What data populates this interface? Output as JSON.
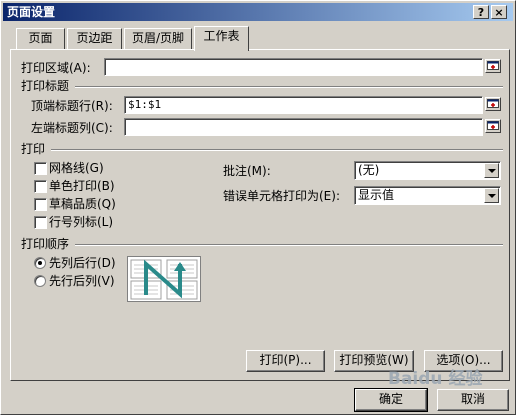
{
  "window": {
    "title": "页面设置",
    "help_label": "?",
    "close_label": "×"
  },
  "tabs": [
    {
      "label": "页面"
    },
    {
      "label": "页边距"
    },
    {
      "label": "页眉/页脚"
    },
    {
      "label": "工作表"
    }
  ],
  "print_area": {
    "label": "打印区域(A):",
    "value": ""
  },
  "print_titles": {
    "header": "打印标题",
    "rows_label": "顶端标题行(R):",
    "rows_value": "$1:$1",
    "cols_label": "左端标题列(C):",
    "cols_value": ""
  },
  "print": {
    "header": "打印",
    "gridlines": {
      "label": "网格线(G)",
      "checked": false
    },
    "black_white": {
      "label": "单色打印(B)",
      "checked": false
    },
    "draft": {
      "label": "草稿品质(Q)",
      "checked": false
    },
    "row_col_headings": {
      "label": "行号列标(L)",
      "checked": false
    },
    "comments_label": "批注(M):",
    "comments_value": "(无)",
    "errors_label": "错误单元格打印为(E):",
    "errors_value": "显示值"
  },
  "page_order": {
    "header": "打印顺序",
    "down_then_over": {
      "label": "先列后行(D)",
      "selected": true
    },
    "over_then_down": {
      "label": "先行后列(V)",
      "selected": false
    }
  },
  "panel_buttons": {
    "print": "打印(P)...",
    "preview": "打印预览(W)",
    "options": "选项(O)..."
  },
  "footer_buttons": {
    "ok": "确定",
    "cancel": "取消"
  },
  "watermark": "Baidu 经验",
  "colors": {
    "title_start": "#0a246a",
    "title_end": "#a6caf0",
    "face": "#d4d0c8",
    "preview_arrow": "#2a8a8a"
  }
}
